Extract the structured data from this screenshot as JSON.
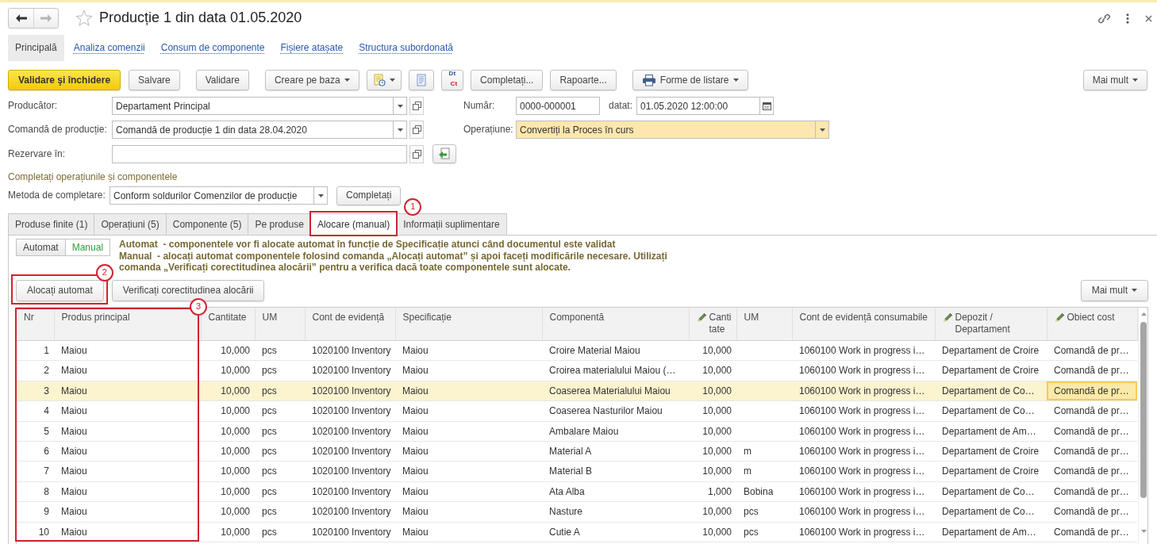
{
  "window": {
    "title": "Producție 1 din data 01.05.2020",
    "favorite": false,
    "back_enabled": true,
    "forward_enabled": false
  },
  "nav": [
    {
      "label": "Principală",
      "selected": true
    },
    {
      "label": "Analiza comenzii",
      "selected": false
    },
    {
      "label": "Consum de componente",
      "selected": false
    },
    {
      "label": "Fișiere atașate",
      "selected": false
    },
    {
      "label": "Structura subordonată",
      "selected": false
    }
  ],
  "toolbar": [
    {
      "kind": "primary",
      "label": "Validare şi închidere"
    },
    {
      "kind": "button",
      "label": "Salvare"
    },
    {
      "kind": "button",
      "label": "Validare"
    },
    {
      "kind": "menu",
      "label": "Creare pe baza"
    },
    {
      "kind": "docmenu"
    },
    {
      "kind": "sheet"
    },
    {
      "kind": "dtct",
      "top": "Dt",
      "bottom": "Ct"
    },
    {
      "kind": "button",
      "label": "Completați..."
    },
    {
      "kind": "button",
      "label": "Rapoarte..."
    },
    {
      "kind": "print",
      "label": "Forme de listare"
    },
    {
      "kind": "more",
      "label": "Mai mult"
    }
  ],
  "fields": [
    {
      "label": "Producător:",
      "value": "Departament Principal",
      "dropdown": true,
      "action_button": false
    },
    {
      "label": "Comandă de producție:",
      "value": "Comandă de producție 1 din data 28.04.2020",
      "dropdown": true,
      "action_button": false
    },
    {
      "label": "Rezervare în:",
      "dropdown": false,
      "action_button": true
    }
  ],
  "number": {
    "label": "Număr:",
    "value": "0000-000001"
  },
  "date": {
    "label": "datat:",
    "value": "01.05.2020 12:00:00"
  },
  "operation": {
    "label": "Operațiune:",
    "value": "Convertiți la Proces în curs",
    "highlighted": true
  },
  "fill_section": {
    "title": "Completați operațiunile și componentele",
    "method_label": "Metoda de completare:",
    "method_value": "Conform soldurilor Comenzilor de producție",
    "button": "Completați"
  },
  "tabs": [
    {
      "label": "Produse finite (1)",
      "selected": false,
      "marked": false
    },
    {
      "label": "Operațiuni (5)",
      "selected": false,
      "marked": false
    },
    {
      "label": "Componente (5)",
      "selected": false,
      "marked": false
    },
    {
      "label": "Pe produse",
      "selected": false,
      "marked": false
    },
    {
      "label": "Alocare (manual)",
      "selected": true,
      "marked": true,
      "callout": "1"
    },
    {
      "label": "Informații suplimentare",
      "selected": false,
      "marked": false
    }
  ],
  "allocation_mode": [
    {
      "label": "Automat",
      "selected": false
    },
    {
      "label": "Manual",
      "selected": true
    }
  ],
  "hints": [
    "Automat  - componentele vor fi alocate automat în funcție de Specificație atunci când documentul este validat",
    "Manual  - alocați automat componentele folosind comanda „Alocați automat” și apoi faceți modificările necesare. Utilizați comanda „Verificați corectitudinea alocării” pentru a verifica dacă toate componentele sunt alocate."
  ],
  "actions": [
    {
      "label": "Alocați automat",
      "marked": true,
      "callout": "2"
    },
    {
      "label": "Verificați corectitudinea alocării",
      "marked": false
    }
  ],
  "more_button": "Mai mult",
  "table": {
    "callout": "3",
    "columns": [
      {
        "label": "Nr",
        "kind": "number",
        "editable": false,
        "marked": true,
        "current": false
      },
      {
        "label": "Produs principal",
        "kind": "text",
        "editable": false,
        "marked": true,
        "current": false
      },
      {
        "label": "Cantitate",
        "kind": "number",
        "editable": false,
        "marked": false,
        "current": false
      },
      {
        "label": "UM",
        "kind": "text",
        "editable": false,
        "marked": false,
        "current": false
      },
      {
        "label": "Cont de evidență",
        "kind": "text",
        "editable": false,
        "marked": false,
        "current": false
      },
      {
        "label": "Specificație",
        "kind": "text",
        "editable": false,
        "marked": false,
        "current": false
      },
      {
        "label": "Componentă",
        "kind": "text",
        "editable": false,
        "marked": false,
        "current": false
      },
      {
        "label": "Cantitate",
        "kind": "number",
        "editable": true,
        "marked": false,
        "current": false
      },
      {
        "label": "UM",
        "kind": "text",
        "editable": false,
        "marked": false,
        "current": false
      },
      {
        "label": "Cont de evidență consumabile",
        "kind": "text",
        "editable": false,
        "marked": false,
        "current": false
      },
      {
        "label": "Depozit / Departament",
        "kind": "text",
        "editable": true,
        "marked": false,
        "current": false
      },
      {
        "label": "Obiect cost",
        "kind": "text",
        "editable": true,
        "marked": false,
        "current": true
      }
    ],
    "rows": [
      {
        "selected": false,
        "cells": [
          "1",
          "Maiou",
          "10,000",
          "pcs",
          "1020100 Inventory",
          "Maiou",
          "Croire Material Maiou",
          "10,000",
          null,
          "1060100 Work in progress i…",
          "Departament de Croire",
          "Comandă de pr…"
        ]
      },
      {
        "selected": false,
        "cells": [
          "2",
          "Maiou",
          "10,000",
          "pcs",
          "1020100 Inventory",
          "Maiou",
          "Croirea materialului Maiou (…",
          "10,000",
          null,
          "1060100 Work in progress i…",
          "Departament de Croire",
          "Comandă de pr…"
        ]
      },
      {
        "selected": true,
        "cells": [
          "3",
          "Maiou",
          "10,000",
          "pcs",
          "1020100 Inventory",
          "Maiou",
          "Coaserea Materialului Maiou",
          "10,000",
          null,
          "1060100 Work in progress i…",
          "Departament de Co…",
          "Comandă de pr…"
        ]
      },
      {
        "selected": false,
        "cells": [
          "4",
          "Maiou",
          "10,000",
          "pcs",
          "1020100 Inventory",
          "Maiou",
          "Coaserea Nasturilor Maiou",
          "10,000",
          null,
          "1060100 Work in progress i…",
          "Departament de Co…",
          "Comandă de pr…"
        ]
      },
      {
        "selected": false,
        "cells": [
          "5",
          "Maiou",
          "10,000",
          "pcs",
          "1020100 Inventory",
          "Maiou",
          "Ambalare Maiou",
          "10,000",
          null,
          "1060100 Work in progress i…",
          "Departament de Am…",
          "Comandă de pr…"
        ]
      },
      {
        "selected": false,
        "cells": [
          "6",
          "Maiou",
          "10,000",
          "pcs",
          "1020100 Inventory",
          "Maiou",
          "Material A",
          "10,000",
          "m",
          "1060100 Work in progress i…",
          "Departament de Croire",
          "Comandă de pr…"
        ]
      },
      {
        "selected": false,
        "cells": [
          "7",
          "Maiou",
          "10,000",
          "pcs",
          "1020100 Inventory",
          "Maiou",
          "Material B",
          "10,000",
          "m",
          "1060100 Work in progress i…",
          "Departament de Croire",
          "Comandă de pr…"
        ]
      },
      {
        "selected": false,
        "cells": [
          "8",
          "Maiou",
          "10,000",
          "pcs",
          "1020100 Inventory",
          "Maiou",
          "Ata Alba",
          "1,000",
          "Bobina",
          "1060100 Work in progress i…",
          "Departament de Co…",
          "Comandă de pr…"
        ]
      },
      {
        "selected": false,
        "cells": [
          "9",
          "Maiou",
          "10,000",
          "pcs",
          "1020100 Inventory",
          "Maiou",
          "Nasture",
          "10,000",
          "pcs",
          "1060100 Work in progress i…",
          "Departament de Co…",
          "Comandă de pr…"
        ]
      },
      {
        "selected": false,
        "cells": [
          "10",
          "Maiou",
          "10,000",
          "pcs",
          "1020100 Inventory",
          "Maiou",
          "Cutie A",
          "10,000",
          "pcs",
          "1060100 Work in progress i…",
          "Departament de Am…",
          "Comandă de pr…"
        ]
      }
    ]
  }
}
